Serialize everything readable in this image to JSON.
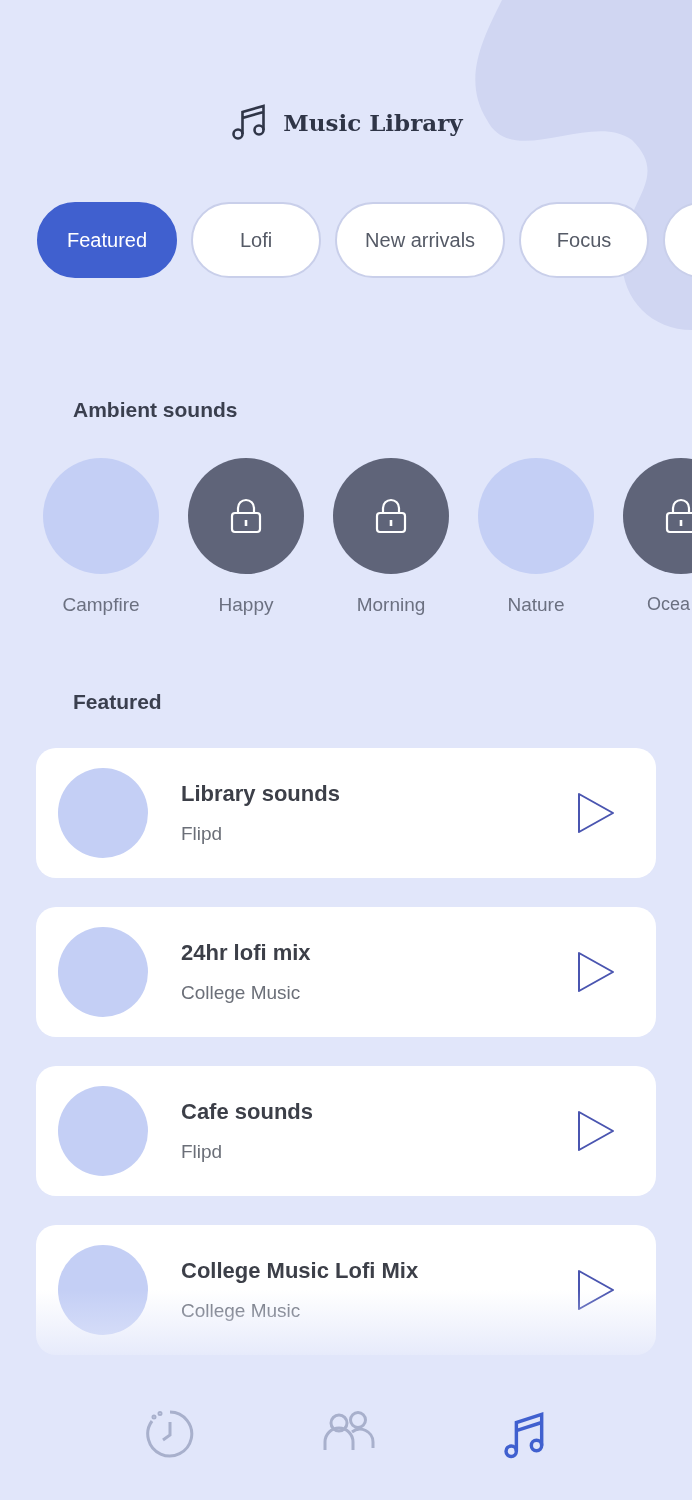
{
  "header": {
    "title": "Music Library"
  },
  "chips": [
    {
      "label": "Featured",
      "selected": true
    },
    {
      "label": "Lofi",
      "selected": false
    },
    {
      "label": "New arrivals",
      "selected": false
    },
    {
      "label": "Focus",
      "selected": false
    },
    {
      "selected": false
    }
  ],
  "ambient": {
    "title": "Ambient sounds",
    "items": [
      {
        "label": "Campfire",
        "locked": false
      },
      {
        "label": "Happy",
        "locked": true
      },
      {
        "label": "Morning",
        "locked": true
      },
      {
        "label": "Nature",
        "locked": false
      },
      {
        "label": "Ocea",
        "locked": true
      }
    ]
  },
  "featured": {
    "title": "Featured",
    "items": [
      {
        "title": "Library sounds",
        "artist": "Flipd"
      },
      {
        "title": "24hr lofi mix",
        "artist": "College Music"
      },
      {
        "title": "Cafe sounds",
        "artist": "Flipd"
      },
      {
        "title": "College Music Lofi Mix",
        "artist": "College Music"
      }
    ]
  },
  "nav": [
    {
      "kind": "timer",
      "selected": false
    },
    {
      "kind": "community",
      "selected": false
    },
    {
      "kind": "music",
      "selected": true
    }
  ]
}
